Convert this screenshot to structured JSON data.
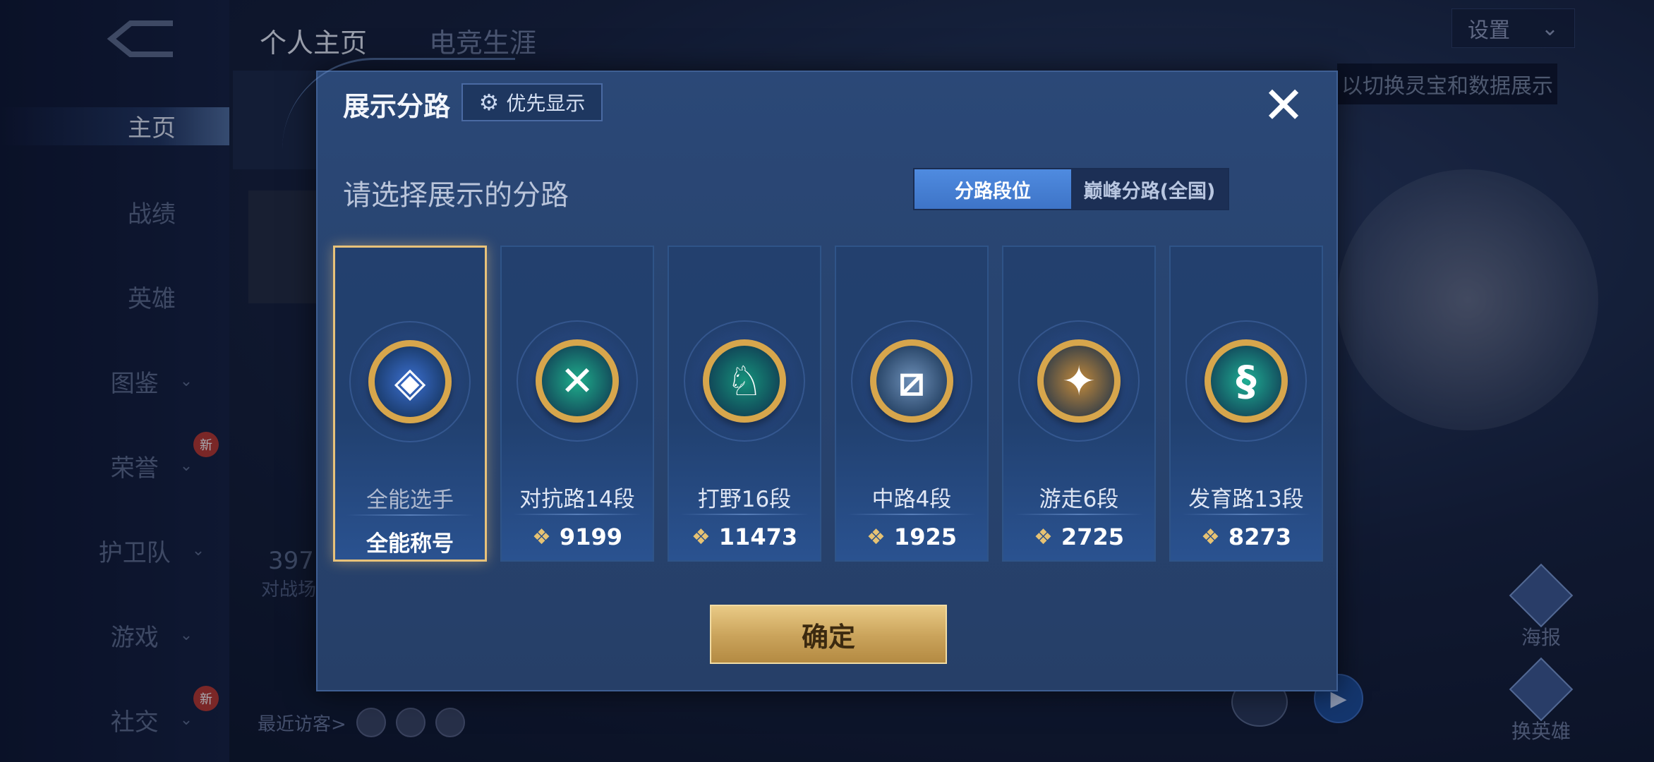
{
  "background": {
    "top_tabs": [
      "个人主页",
      "电竞生涯"
    ],
    "sidebar": [
      {
        "label": "主页",
        "active": true,
        "chevron": false,
        "new": false
      },
      {
        "label": "战绩",
        "active": false,
        "chevron": false,
        "new": false
      },
      {
        "label": "英雄",
        "active": false,
        "chevron": false,
        "new": false
      },
      {
        "label": "图鉴",
        "active": false,
        "chevron": true,
        "new": false
      },
      {
        "label": "荣誉",
        "active": false,
        "chevron": true,
        "new": true
      },
      {
        "label": "护卫队",
        "active": false,
        "chevron": true,
        "new": false
      },
      {
        "label": "游戏",
        "active": false,
        "chevron": true,
        "new": false
      },
      {
        "label": "社交",
        "active": false,
        "chevron": true,
        "new": true
      }
    ],
    "new_badge": "新",
    "settings_label": "设置",
    "tip_text": "以切换灵宝和数据展示",
    "stat_value": "397",
    "stat_label": "对战场",
    "recent_visitors": "最近访客>",
    "poster_label": "海报",
    "switch_hero_label": "换英雄"
  },
  "modal": {
    "title": "展示分路",
    "priority_label": "优先显示",
    "subtitle": "请选择展示的分路",
    "toggle": {
      "left": "分路段位",
      "right": "巅峰分路(全国)",
      "active": "left"
    },
    "cards": [
      {
        "label": "全能选手",
        "title": "全能称号",
        "score": null,
        "badge_color": "#3b6fd0",
        "icon": "allround-icon",
        "selected": true
      },
      {
        "label": "对抗路14段",
        "score": "9199",
        "badge_color": "#1fae8c",
        "icon": "clash-lane-icon",
        "selected": false
      },
      {
        "label": "打野16段",
        "score": "11473",
        "badge_color": "#16937c",
        "icon": "jungle-icon",
        "selected": false
      },
      {
        "label": "中路4段",
        "score": "1925",
        "badge_color": "#6d8fb8",
        "icon": "mid-lane-icon",
        "selected": false
      },
      {
        "label": "游走6段",
        "score": "2725",
        "badge_color": "#c28a3c",
        "icon": "roam-icon",
        "selected": false
      },
      {
        "label": "发育路13段",
        "score": "8273",
        "badge_color": "#1faf94",
        "icon": "farm-lane-icon",
        "selected": false
      }
    ],
    "confirm_label": "确定"
  }
}
